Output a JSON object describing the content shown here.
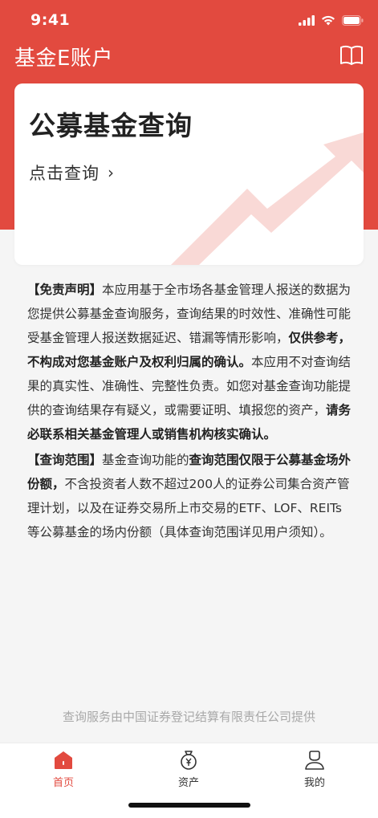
{
  "status_bar": {
    "time": "9:41"
  },
  "header": {
    "title": "基金E账户",
    "book_icon": "book-icon"
  },
  "card": {
    "title": "公募基金查询",
    "link_label": "点击查询",
    "chevron": "›"
  },
  "disclaimer": {
    "p1": [
      {
        "t": "【免责声明】",
        "b": true
      },
      {
        "t": "本应用基于全市场各基金管理人报送的数据为您提供公募基金查询服务，查询结果的时效性、准确性可能受基金管理人报送数据延迟、错漏等情形影响，",
        "b": false
      },
      {
        "t": "仅供参考，不构成对您基金账户及权利归属的确认。",
        "b": true
      },
      {
        "t": "本应用不对查询结果的真实性、准确性、完整性负责。如您对基金查询功能提供的查询结果存有疑义，或需要证明、填报您的资产，",
        "b": false
      },
      {
        "t": "请务必联系相关基金管理人或销售机构核实确认。",
        "b": true
      }
    ],
    "p2": [
      {
        "t": "【查询范围】",
        "b": true
      },
      {
        "t": "基金查询功能的",
        "b": false
      },
      {
        "t": "查询范围仅限于公募基金场外份额，",
        "b": true
      },
      {
        "t": "不含投资者人数不超过200人的证券公司集合资产管理计划，以及在证券交易所上市交易的ETF、LOF、REITs等公募基金的场内份额（具体查询范围详见用户须知）。",
        "b": false
      }
    ]
  },
  "footer": {
    "provider": "查询服务由中国证券登记结算有限责任公司提供"
  },
  "tabs": [
    {
      "label": "首页",
      "icon": "home-icon",
      "active": true
    },
    {
      "label": "资产",
      "icon": "money-bag-icon",
      "active": false
    },
    {
      "label": "我的",
      "icon": "user-icon",
      "active": false
    }
  ],
  "colors": {
    "brand": "#e24a3f",
    "background": "#f5f5f5",
    "deco": "#f9d9d6"
  }
}
